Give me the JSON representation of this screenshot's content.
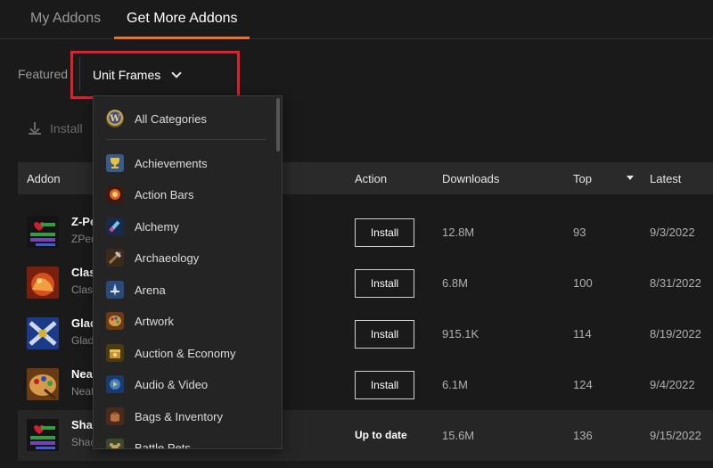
{
  "tabs": [
    {
      "label": "My Addons",
      "active": false
    },
    {
      "label": "Get More Addons",
      "active": true
    }
  ],
  "filter": {
    "featured_label": "Featured",
    "selected_category": "Unit Frames"
  },
  "toolbar": {
    "install_label": "Install"
  },
  "table": {
    "headers": {
      "addon": "Addon",
      "action": "Action",
      "downloads": "Downloads",
      "top": "Top",
      "latest": "Latest"
    },
    "rows": [
      {
        "name": "Z-Pe",
        "author": "ZPer",
        "action": "Install",
        "downloads": "12.8M",
        "top": "93",
        "latest": "9/3/2022"
      },
      {
        "name": "Clas",
        "author": "Clas",
        "action": "Install",
        "downloads": "6.8M",
        "top": "100",
        "latest": "8/31/2022"
      },
      {
        "name": "Glad",
        "author": "Glad",
        "action": "Install",
        "downloads": "915.1K",
        "top": "114",
        "latest": "8/19/2022"
      },
      {
        "name": "Neat",
        "author": "Neat",
        "action": "Install",
        "downloads": "6.1M",
        "top": "124",
        "latest": "9/4/2022"
      },
      {
        "name": "Shac",
        "author": "Shac",
        "action": "Up to date",
        "downloads": "15.6M",
        "top": "136",
        "latest": "9/15/2022"
      }
    ]
  },
  "dropdown": {
    "items": [
      {
        "label": "All Categories",
        "icon": "wow-logo-icon"
      },
      {
        "label": "Achievements",
        "icon": "achievements-icon"
      },
      {
        "label": "Action Bars",
        "icon": "action-bars-icon"
      },
      {
        "label": "Alchemy",
        "icon": "alchemy-icon"
      },
      {
        "label": "Archaeology",
        "icon": "archaeology-icon"
      },
      {
        "label": "Arena",
        "icon": "arena-icon"
      },
      {
        "label": "Artwork",
        "icon": "artwork-icon"
      },
      {
        "label": "Auction & Economy",
        "icon": "auction-economy-icon"
      },
      {
        "label": "Audio & Video",
        "icon": "audio-video-icon"
      },
      {
        "label": "Bags & Inventory",
        "icon": "bags-inventory-icon"
      },
      {
        "label": "Battle Pets",
        "icon": "battle-pets-icon"
      }
    ]
  },
  "colors": {
    "accent": "#e8722a",
    "highlight_box": "#e0202a",
    "background": "#1a1a1a"
  }
}
